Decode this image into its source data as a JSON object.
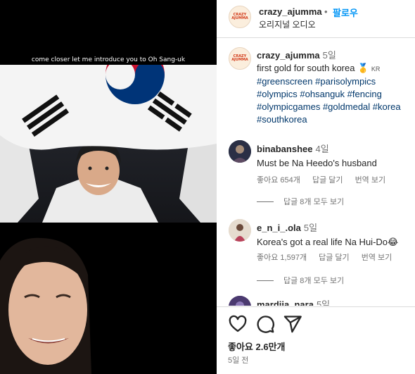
{
  "post": {
    "caption_overlay": "come closer let me introduce you to Oh Sang-uk"
  },
  "header": {
    "logo_text": "CRAZY AJUMMA",
    "username": "crazy_ajumma",
    "dot": "•",
    "follow_label": "팔로우",
    "audio": "오리지널 오디오"
  },
  "caption": {
    "username": "crazy_ajumma",
    "time": "5일",
    "text": "first gold for south korea 🥇",
    "flag_text": "KR",
    "hashtags": [
      "#greenscreen",
      "#parisolympics",
      "#olympics",
      "#ohsanguk",
      "#fencing",
      "#olympicgames",
      "#goldmedal",
      "#korea",
      "#southkorea"
    ]
  },
  "comments": [
    {
      "username": "binabanshee",
      "time": "4일",
      "text": "Must be Na Heedo's husband",
      "likes": "좋아요 654개",
      "reply": "답글 달기",
      "translate": "번역 보기",
      "view_replies": "답글 8개 모두 보기"
    },
    {
      "username": "e_n_i_.ola",
      "time": "5일",
      "text": "Korea's got a real life Na Hui-Do😂",
      "likes": "좋아요 1,597개",
      "reply": "답글 달기",
      "translate": "번역 보기",
      "view_replies": "답글 8개 모두 보기"
    },
    {
      "username": "mardiia_nara",
      "time": "5일"
    }
  ],
  "actions": {
    "like_icon": "heart-icon",
    "comment_icon": "comment-icon",
    "share_icon": "send-icon"
  },
  "footer": {
    "likes": "좋아요 2.6만개",
    "date": "5일 전"
  },
  "colors": {
    "accent": "#0095f6",
    "hashtag": "#00376b",
    "muted": "#737373"
  }
}
